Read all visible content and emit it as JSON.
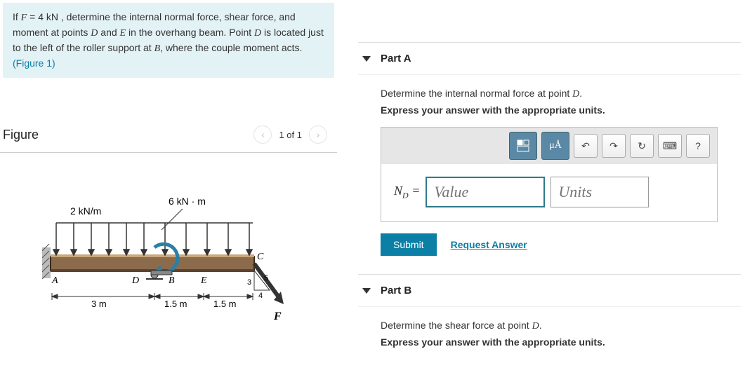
{
  "problem": {
    "prefix": "If ",
    "force_var": "F",
    "force_eq": " = 4 kN",
    "text1": " , determine the internal normal force, shear force, and moment at points ",
    "pointD": "D",
    "and": " and ",
    "pointE": "E",
    "text2": " in the overhang beam. Point ",
    "text3": " is located just to the left of the roller support at ",
    "pointB": "B",
    "text4": ", where the couple moment acts.",
    "figref": "(Figure 1)"
  },
  "figureHeader": {
    "title": "Figure",
    "counter": "1 of 1"
  },
  "diagram": {
    "distLoad": "2 kN/m",
    "moment": "6 kN · m",
    "labelA": "A",
    "labelB": "B",
    "labelC": "C",
    "labelD": "D",
    "labelE": "E",
    "labelF": "F",
    "dim1": "3 m",
    "dim2": "1.5 m",
    "dim3": "1.5 m",
    "tri1": "3",
    "tri2": "4",
    "tri3": "5"
  },
  "partA": {
    "title": "Part A",
    "prompt1": "Determine the internal normal force at point ",
    "promptVar": "D",
    "prompt2": ".",
    "subPrompt": "Express your answer with the appropriate units.",
    "varLabel": "N",
    "varSub": "D",
    "eq": " = ",
    "valuePlaceholder": "Value",
    "unitsPlaceholder": "Units",
    "submit": "Submit",
    "request": "Request Answer",
    "mu": "μÅ",
    "help": "?"
  },
  "partB": {
    "title": "Part B",
    "prompt1": "Determine the shear force at point ",
    "promptVar": "D",
    "prompt2": ".",
    "subPrompt": "Express your answer with the appropriate units."
  }
}
